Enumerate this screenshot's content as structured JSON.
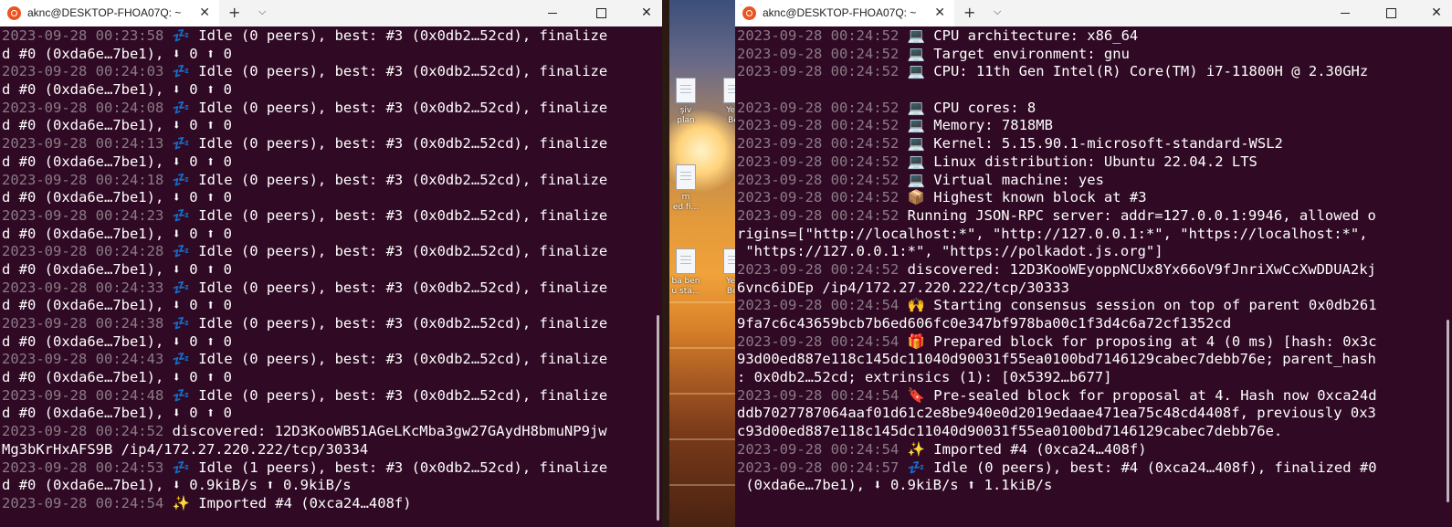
{
  "desktop": {
    "icons": [
      {
        "caption_1": "şiv",
        "caption_2": "plan"
      },
      {
        "caption_1": "Yen",
        "caption_2": "Be"
      },
      {
        "caption_1": "m",
        "caption_2": "ed fi..."
      },
      {
        "caption_1": "ba ben",
        "caption_2": "u sta..."
      },
      {
        "caption_1": "Yen",
        "caption_2": "Bel"
      }
    ]
  },
  "left_terminal": {
    "tab_title": "aknc@DESKTOP-FHOA07Q: ~",
    "close_glyph": "✕",
    "new_tab_glyph": "+",
    "menu_glyph": "⌵",
    "lines": [
      {
        "ts": "2023-09-28 00:23:58",
        "text": " 💤 Idle (0 peers), best: #3 (0x0db2…52cd), finalize"
      },
      {
        "ts": "",
        "text": "d #0 (0xda6e…7be1), ⬇ 0 ⬆ 0"
      },
      {
        "ts": "2023-09-28 00:24:03",
        "text": " 💤 Idle (0 peers), best: #3 (0x0db2…52cd), finalize"
      },
      {
        "ts": "",
        "text": "d #0 (0xda6e…7be1), ⬇ 0 ⬆ 0"
      },
      {
        "ts": "2023-09-28 00:24:08",
        "text": " 💤 Idle (0 peers), best: #3 (0x0db2…52cd), finalize"
      },
      {
        "ts": "",
        "text": "d #0 (0xda6e…7be1), ⬇ 0 ⬆ 0"
      },
      {
        "ts": "2023-09-28 00:24:13",
        "text": " 💤 Idle (0 peers), best: #3 (0x0db2…52cd), finalize"
      },
      {
        "ts": "",
        "text": "d #0 (0xda6e…7be1), ⬇ 0 ⬆ 0"
      },
      {
        "ts": "2023-09-28 00:24:18",
        "text": " 💤 Idle (0 peers), best: #3 (0x0db2…52cd), finalize"
      },
      {
        "ts": "",
        "text": "d #0 (0xda6e…7be1), ⬇ 0 ⬆ 0"
      },
      {
        "ts": "2023-09-28 00:24:23",
        "text": " 💤 Idle (0 peers), best: #3 (0x0db2…52cd), finalize"
      },
      {
        "ts": "",
        "text": "d #0 (0xda6e…7be1), ⬇ 0 ⬆ 0"
      },
      {
        "ts": "2023-09-28 00:24:28",
        "text": " 💤 Idle (0 peers), best: #3 (0x0db2…52cd), finalize"
      },
      {
        "ts": "",
        "text": "d #0 (0xda6e…7be1), ⬇ 0 ⬆ 0"
      },
      {
        "ts": "2023-09-28 00:24:33",
        "text": " 💤 Idle (0 peers), best: #3 (0x0db2…52cd), finalize"
      },
      {
        "ts": "",
        "text": "d #0 (0xda6e…7be1), ⬇ 0 ⬆ 0"
      },
      {
        "ts": "2023-09-28 00:24:38",
        "text": " 💤 Idle (0 peers), best: #3 (0x0db2…52cd), finalize"
      },
      {
        "ts": "",
        "text": "d #0 (0xda6e…7be1), ⬇ 0 ⬆ 0"
      },
      {
        "ts": "2023-09-28 00:24:43",
        "text": " 💤 Idle (0 peers), best: #3 (0x0db2…52cd), finalize"
      },
      {
        "ts": "",
        "text": "d #0 (0xda6e…7be1), ⬇ 0 ⬆ 0"
      },
      {
        "ts": "2023-09-28 00:24:48",
        "text": " 💤 Idle (0 peers), best: #3 (0x0db2…52cd), finalize"
      },
      {
        "ts": "",
        "text": "d #0 (0xda6e…7be1), ⬇ 0 ⬆ 0"
      },
      {
        "ts": "2023-09-28 00:24:52",
        "text": " discovered: 12D3KooWB51AGeLKcMba3gw27GAydH8bmuNP9jw"
      },
      {
        "ts": "",
        "text": "Mg3bKrHxAFS9B /ip4/172.27.220.222/tcp/30334"
      },
      {
        "ts": "2023-09-28 00:24:53",
        "text": " 💤 Idle (1 peers), best: #3 (0x0db2…52cd), finalize"
      },
      {
        "ts": "",
        "text": "d #0 (0xda6e…7be1), ⬇ 0.9kiB/s ⬆ 0.9kiB/s"
      },
      {
        "ts": "2023-09-28 00:24:54",
        "text": " ✨ Imported #4 (0xca24…408f)"
      }
    ]
  },
  "right_terminal": {
    "tab_title": "aknc@DESKTOP-FHOA07Q: ~",
    "close_glyph": "✕",
    "new_tab_glyph": "+",
    "menu_glyph": "⌵",
    "lines": [
      {
        "ts": "2023-09-28 00:24:52",
        "text": " 💻 CPU architecture: x86_64"
      },
      {
        "ts": "2023-09-28 00:24:52",
        "text": " 💻 Target environment: gnu"
      },
      {
        "ts": "2023-09-28 00:24:52",
        "text": " 💻 CPU: 11th Gen Intel(R) Core(TM) i7-11800H @ 2.30GHz"
      },
      {
        "ts": "",
        "text": ""
      },
      {
        "ts": "2023-09-28 00:24:52",
        "text": " 💻 CPU cores: 8"
      },
      {
        "ts": "2023-09-28 00:24:52",
        "text": " 💻 Memory: 7818MB"
      },
      {
        "ts": "2023-09-28 00:24:52",
        "text": " 💻 Kernel: 5.15.90.1-microsoft-standard-WSL2"
      },
      {
        "ts": "2023-09-28 00:24:52",
        "text": " 💻 Linux distribution: Ubuntu 22.04.2 LTS"
      },
      {
        "ts": "2023-09-28 00:24:52",
        "text": " 💻 Virtual machine: yes"
      },
      {
        "ts": "2023-09-28 00:24:52",
        "text": " 📦 Highest known block at #3"
      },
      {
        "ts": "2023-09-28 00:24:52",
        "text": " Running JSON-RPC server: addr=127.0.0.1:9946, allowed o"
      },
      {
        "ts": "",
        "text": "rigins=[\"http://localhost:*\", \"http://127.0.0.1:*\", \"https://localhost:*\","
      },
      {
        "ts": "",
        "text": " \"https://127.0.0.1:*\", \"https://polkadot.js.org\"]"
      },
      {
        "ts": "2023-09-28 00:24:52",
        "text": " discovered: 12D3KooWEyoppNCUx8Yx66oV9fJnriXwCcXwDDUA2kj"
      },
      {
        "ts": "",
        "text": "6vnc6iDEp /ip4/172.27.220.222/tcp/30333"
      },
      {
        "ts": "2023-09-28 00:24:54",
        "text": " 🙌 Starting consensus session on top of parent 0x0db261"
      },
      {
        "ts": "",
        "text": "9fa7c6c43659bcb7b6ed606fc0e347bf978ba00c1f3d4c6a72cf1352cd"
      },
      {
        "ts": "2023-09-28 00:24:54",
        "text": " 🎁 Prepared block for proposing at 4 (0 ms) [hash: 0x3c"
      },
      {
        "ts": "",
        "text": "93d00ed887e118c145dc11040d90031f55ea0100bd7146129cabec7debb76e; parent_hash"
      },
      {
        "ts": "",
        "text": ": 0x0db2…52cd; extrinsics (1): [0x5392…b677]"
      },
      {
        "ts": "2023-09-28 00:24:54",
        "text": " 🔖 Pre-sealed block for proposal at 4. Hash now 0xca24d"
      },
      {
        "ts": "",
        "text": "ddb7027787064aaf01d61c2e8be940e0d2019edaae471ea75c48cd4408f, previously 0x3"
      },
      {
        "ts": "",
        "text": "c93d00ed887e118c145dc11040d90031f55ea0100bd7146129cabec7debb76e."
      },
      {
        "ts": "2023-09-28 00:24:54",
        "text": " ✨ Imported #4 (0xca24…408f)"
      },
      {
        "ts": "2023-09-28 00:24:57",
        "text": " 💤 Idle (0 peers), best: #4 (0xca24…408f), finalized #0"
      },
      {
        "ts": "",
        "text": " (0xda6e…7be1), ⬇ 0.9kiB/s ⬆ 1.1kiB/s"
      }
    ]
  }
}
